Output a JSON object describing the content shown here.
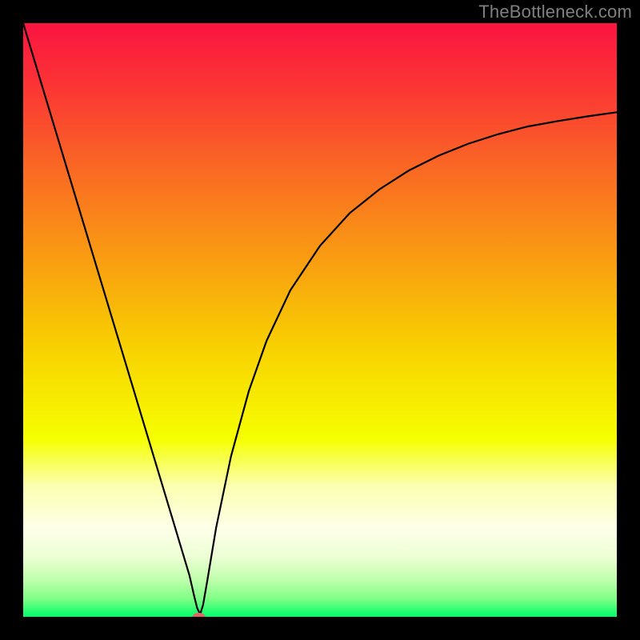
{
  "watermark": "TheBottleneck.com",
  "chart_data": {
    "type": "line",
    "title": "",
    "xlabel": "",
    "ylabel": "",
    "xlim": [
      0,
      100
    ],
    "ylim": [
      0,
      100
    ],
    "grid": false,
    "legend": false,
    "background_gradient": {
      "stops": [
        {
          "offset": 0.0,
          "color": "#fb1441"
        },
        {
          "offset": 0.1,
          "color": "#fb3336"
        },
        {
          "offset": 0.25,
          "color": "#fa6a23"
        },
        {
          "offset": 0.4,
          "color": "#f99e11"
        },
        {
          "offset": 0.55,
          "color": "#f8d200"
        },
        {
          "offset": 0.7,
          "color": "#f6ff00"
        },
        {
          "offset": 0.78,
          "color": "#fbffb0"
        },
        {
          "offset": 0.85,
          "color": "#feffe8"
        },
        {
          "offset": 0.9,
          "color": "#ecffd4"
        },
        {
          "offset": 0.94,
          "color": "#bcffaa"
        },
        {
          "offset": 0.97,
          "color": "#7eff86"
        },
        {
          "offset": 1.0,
          "color": "#00ff6a"
        }
      ]
    },
    "series": [
      {
        "name": "curve",
        "color": "#000000",
        "x": [
          0.0,
          2.5,
          5.0,
          7.5,
          10.0,
          12.5,
          15.0,
          17.5,
          20.0,
          22.5,
          25.0,
          26.5,
          28.0,
          28.8,
          29.3,
          29.8,
          30.3,
          31.0,
          32.5,
          35.0,
          38.0,
          41.0,
          45.0,
          50.0,
          55.0,
          60.0,
          65.0,
          70.0,
          75.0,
          80.0,
          85.0,
          90.0,
          95.0,
          100.0
        ],
        "values": [
          100.0,
          91.7,
          83.4,
          75.1,
          66.8,
          58.5,
          50.2,
          41.9,
          33.6,
          25.3,
          17.0,
          12.0,
          7.0,
          3.5,
          1.5,
          0.4,
          2.0,
          6.0,
          15.0,
          27.0,
          38.0,
          46.5,
          55.0,
          62.5,
          68.0,
          72.0,
          75.2,
          77.7,
          79.7,
          81.3,
          82.6,
          83.5,
          84.3,
          85.0
        ]
      }
    ],
    "marker": {
      "name": "min-point",
      "x": 29.6,
      "y": 0.0,
      "color": "#e06666",
      "rx": 8,
      "ry": 5
    }
  }
}
